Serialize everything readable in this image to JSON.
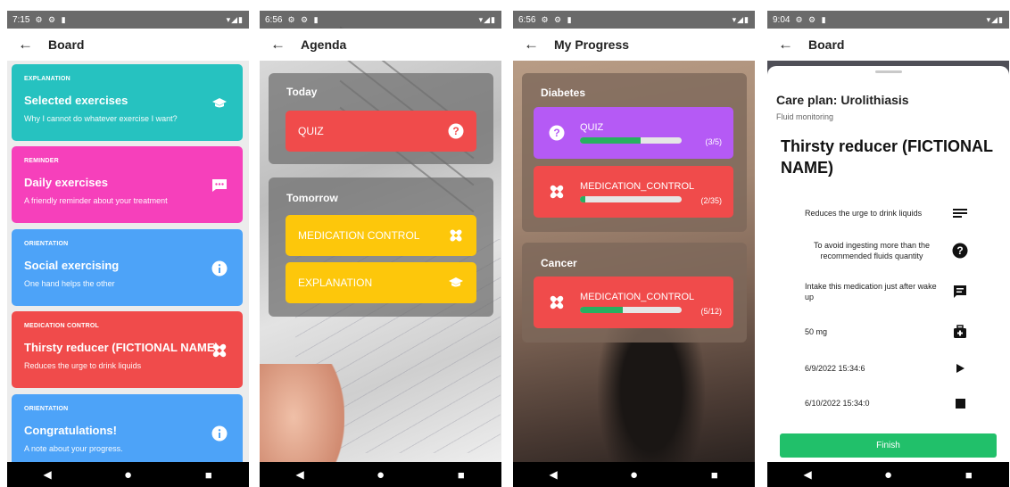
{
  "nav": {
    "back": "◀",
    "home": "●",
    "recent": "■"
  },
  "screen1": {
    "time": "7:15",
    "status_icons": "⚙ ⚙ ▮",
    "status_right": "▾◢▮",
    "title": "Board",
    "cards": [
      {
        "type": "EXPLANATION",
        "title": "Selected exercises",
        "subtitle": "Why I cannot do whatever exercise I want?",
        "icon": "graduation-cap-icon",
        "color": "#26c2c0"
      },
      {
        "type": "REMINDER",
        "title": "Daily exercises",
        "subtitle": "A friendly reminder about your treatment",
        "icon": "chat-bubble-icon",
        "color": "#f640bb"
      },
      {
        "type": "ORIENTATION",
        "title": "Social exercising",
        "subtitle": "One hand helps the other",
        "icon": "info-icon",
        "color": "#4da3f8"
      },
      {
        "type": "MEDICATION CONTROL",
        "title": "Thirsty reducer (FICTIONAL NAME)",
        "subtitle": "Reduces the urge to drink liquids",
        "icon": "bandage-icon",
        "color": "#f04b4b"
      },
      {
        "type": "ORIENTATION",
        "title": "Congratulations!",
        "subtitle": "A note about your progress.",
        "icon": "info-icon",
        "color": "#4da3f8"
      }
    ]
  },
  "screen2": {
    "time": "6:56",
    "status_icons": "⚙ ⚙ ▮",
    "status_right": "▾◢▮",
    "title": "Agenda",
    "sections": [
      {
        "label": "Today",
        "items": [
          {
            "label": "QUIZ",
            "icon": "question-icon",
            "color": "#f04b4b"
          }
        ]
      },
      {
        "label": "Tomorrow",
        "items": [
          {
            "label": "MEDICATION CONTROL",
            "icon": "bandage-icon",
            "color": "#fdc70b"
          },
          {
            "label": "EXPLANATION",
            "icon": "graduation-cap-icon",
            "color": "#fdc70b"
          }
        ]
      }
    ]
  },
  "screen3": {
    "time": "6:56",
    "status_icons": "⚙ ⚙ ▮",
    "status_right": "▾◢▮",
    "title": "My Progress",
    "groups": [
      {
        "label": "Diabetes",
        "items": [
          {
            "label": "QUIZ",
            "count": "(3/5)",
            "progress": 0.6,
            "icon": "question-icon",
            "color": "#b55af5"
          },
          {
            "label": "MEDICATION_CONTROL",
            "count": "(2/35)",
            "progress": 0.057,
            "icon": "bandage-icon",
            "color": "#f04b4b"
          }
        ]
      },
      {
        "label": "Cancer",
        "items": [
          {
            "label": "MEDICATION_CONTROL",
            "count": "(5/12)",
            "progress": 0.42,
            "icon": "bandage-icon",
            "color": "#f04b4b"
          }
        ]
      }
    ]
  },
  "screen4": {
    "time": "9:04",
    "status_icons": "⚙ ⚙ ▮",
    "status_right": "▾◢▮",
    "title": "Board",
    "care_plan": "Care plan: Urolithiasis",
    "care_sub": "Fluid monitoring",
    "medication": "Thirsty reducer (FICTIONAL NAME)",
    "details": [
      {
        "text": "Reduces the urge to drink liquids",
        "icon": "description-lines-icon"
      },
      {
        "text": "To avoid ingesting more than the recommended fluids quantity",
        "icon": "question-icon"
      },
      {
        "text": "Intake this medication just after wake up",
        "icon": "comment-icon"
      },
      {
        "text": "50 mg",
        "icon": "medkit-icon"
      },
      {
        "text": "6/9/2022 15:34:6",
        "icon": "play-icon"
      },
      {
        "text": "6/10/2022 15:34:0",
        "icon": "stop-icon"
      }
    ],
    "finish": "Finish"
  }
}
